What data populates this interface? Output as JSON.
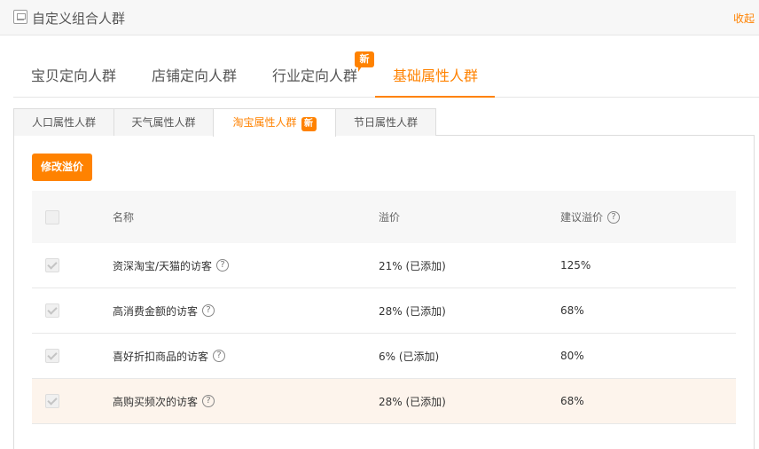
{
  "header": {
    "icon": "panel-icon",
    "title": "自定义组合人群",
    "collapse_label": "收起"
  },
  "main_tabs": [
    {
      "label": "宝贝定向人群",
      "active": false
    },
    {
      "label": "店铺定向人群",
      "active": false
    },
    {
      "label": "行业定向人群",
      "active": false,
      "badge": "新"
    },
    {
      "label": "基础属性人群",
      "active": true
    }
  ],
  "sub_tabs": [
    {
      "label": "人口属性人群",
      "active": false
    },
    {
      "label": "天气属性人群",
      "active": false
    },
    {
      "label": "淘宝属性人群",
      "active": true,
      "badge": "新"
    },
    {
      "label": "节日属性人群",
      "active": false
    }
  ],
  "modify_button": "修改溢价",
  "table": {
    "headers": {
      "name": "名称",
      "premium": "溢价",
      "suggested": "建议溢价",
      "help": "?"
    },
    "rows": [
      {
        "name": "资深淘宝/天猫的访客",
        "help": "?",
        "premium": "21% (已添加)",
        "suggested": "125%",
        "checked": true
      },
      {
        "name": "高消费金额的访客",
        "help": "?",
        "premium": "28% (已添加)",
        "suggested": "68%",
        "checked": true
      },
      {
        "name": "喜好折扣商品的访客",
        "help": "?",
        "premium": "6% (已添加)",
        "suggested": "80%",
        "checked": true
      },
      {
        "name": "高购买频次的访客",
        "help": "?",
        "premium": "28% (已添加)",
        "suggested": "68%",
        "checked": true
      }
    ]
  },
  "colors": {
    "accent": "#ff8200",
    "highlight_row": "#fdf4ec"
  }
}
